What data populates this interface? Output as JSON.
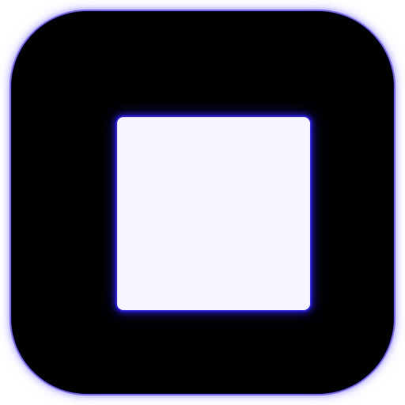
{
  "icon": {
    "name": "stop-icon",
    "background_color": "#000000",
    "glow_color": "#4f3dff",
    "square_color": "#f6f5ff"
  }
}
